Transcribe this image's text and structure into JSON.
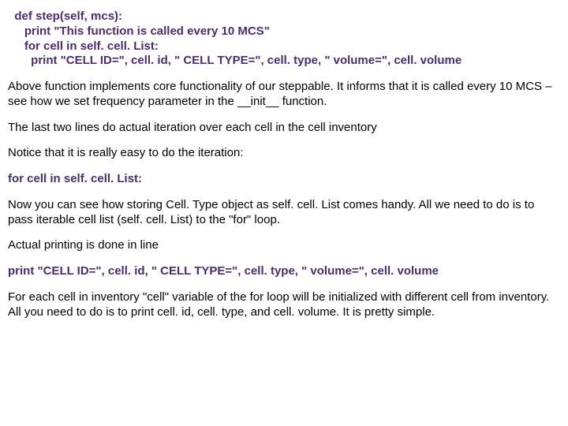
{
  "code": {
    "l1": "  def step(self, mcs):",
    "l2": "     print \"This function is called every 10 MCS\"",
    "l3": "     for cell in self. cell. List:",
    "l4": "       print \"CELL ID=\", cell. id, \" CELL TYPE=\", cell. type, \" volume=\", cell. volume"
  },
  "p1": "Above function implements core functionality of our steppable. It informs that it is called every 10 MCS – see how we set frequency parameter in  the __init__ function.",
  "p2": "The last two lines do actual iteration over each cell in the cell inventory",
  "p3": "Notice that it is really easy to do the iteration:",
  "c1": "for cell in self. cell. List:",
  "p4": "Now you can see how storing Cell. Type object as self. cell. List comes handy. All we need to do is to pass iterable cell list (self. cell. List) to the \"for\" loop.",
  "p5": "Actual printing is done in line",
  "c2": "print \"CELL ID=\", cell. id, \" CELL TYPE=\", cell. type, \" volume=\", cell. volume",
  "p6": "For each cell in inventory \"cell\" variable of the for loop will be initialized with different cell from inventory. All you need to do is to print cell. id, cell. type, and cell. volume. It is pretty simple."
}
